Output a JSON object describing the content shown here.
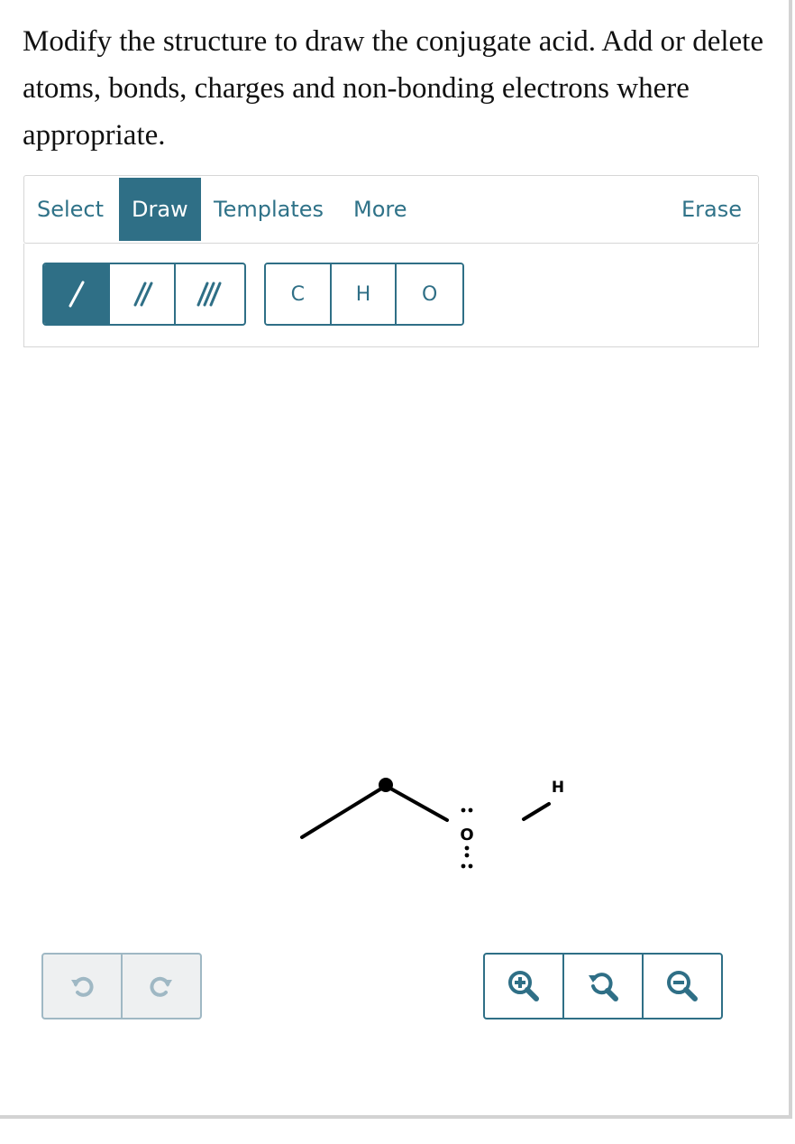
{
  "question": {
    "prompt": "Modify the structure to draw the conjugate acid. Add or delete atoms, bonds, charges and non-bonding electrons where appropriate."
  },
  "tabs": [
    {
      "label": "Select",
      "active": false
    },
    {
      "label": "Draw",
      "active": true
    },
    {
      "label": "Templates",
      "active": false
    },
    {
      "label": "More",
      "active": false
    }
  ],
  "erase_label": "Erase",
  "bond_tools": [
    {
      "name": "single-bond",
      "icon": "single-bond-icon",
      "active": true
    },
    {
      "name": "double-bond",
      "icon": "double-bond-icon",
      "active": false
    },
    {
      "name": "triple-bond",
      "icon": "triple-bond-icon",
      "active": false
    }
  ],
  "atom_tools": [
    {
      "label": "C"
    },
    {
      "label": "H"
    },
    {
      "label": "O"
    }
  ],
  "molecule": {
    "atoms": [
      {
        "symbol": "O",
        "lone_pairs": 3
      },
      {
        "symbol": "H"
      }
    ]
  },
  "history_buttons": [
    {
      "name": "undo",
      "icon": "undo-icon"
    },
    {
      "name": "redo",
      "icon": "redo-icon"
    }
  ],
  "zoom_buttons": [
    {
      "name": "zoom-in",
      "icon": "zoom-in-icon"
    },
    {
      "name": "zoom-reset",
      "icon": "zoom-reset-icon"
    },
    {
      "name": "zoom-out",
      "icon": "zoom-out-icon"
    }
  ],
  "colors": {
    "accent": "#2f6f86",
    "tab_text": "#2f7288",
    "disabled_border": "#9fb8c4",
    "disabled_fill": "#eef0f1"
  }
}
